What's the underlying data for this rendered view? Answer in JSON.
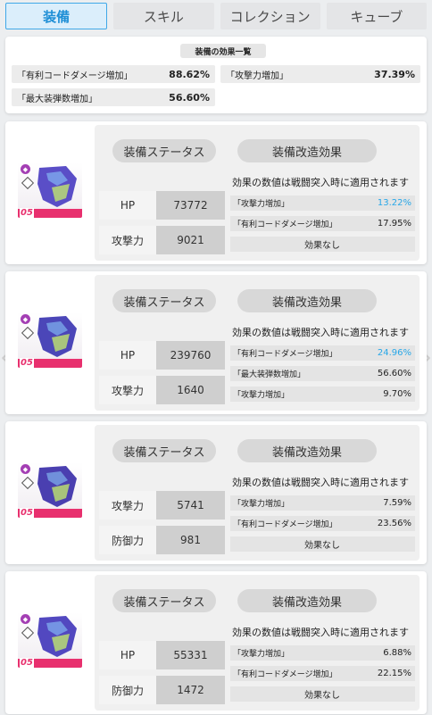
{
  "tabs": [
    {
      "label": "装備",
      "active": true
    },
    {
      "label": "スキル"
    },
    {
      "label": "コレクション"
    },
    {
      "label": "キューブ"
    }
  ],
  "summary": {
    "title": "装備の効果一覧",
    "items": [
      {
        "label": "「有利コードダメージ増加」",
        "value": "88.62%"
      },
      {
        "label": "「攻撃力増加」",
        "value": "37.39%"
      },
      {
        "label": "「最大装弾数増加」",
        "value": "56.60%"
      }
    ]
  },
  "cards": [
    {
      "level": "05",
      "status_header": "装備ステータス",
      "mod_header": "装備改造効果",
      "note": "効果の数値は戦闘突入時に適用されます",
      "stats": [
        {
          "label": "HP",
          "value": "73772"
        },
        {
          "label": "攻撃力",
          "value": "9021"
        }
      ],
      "effects": [
        {
          "label": "「攻撃力増加」",
          "value": "13.22%",
          "highlight": true
        },
        {
          "label": "「有利コードダメージ増加」",
          "value": "17.95%"
        },
        {
          "label": "効果なし",
          "none": true
        }
      ],
      "item_color": "#5a4ec7"
    },
    {
      "level": "05",
      "status_header": "装備ステータス",
      "mod_header": "装備改造効果",
      "note": "効果の数値は戦闘突入時に適用されます",
      "stats": [
        {
          "label": "HP",
          "value": "239760"
        },
        {
          "label": "攻撃力",
          "value": "1640"
        }
      ],
      "effects": [
        {
          "label": "「有利コードダメージ増加」",
          "value": "24.96%",
          "highlight": true
        },
        {
          "label": "「最大装弾数増加」",
          "value": "56.60%"
        },
        {
          "label": "「攻撃力増加」",
          "value": "9.70%"
        }
      ],
      "item_color": "#4b46b8"
    },
    {
      "level": "05",
      "status_header": "装備ステータス",
      "mod_header": "装備改造効果",
      "note": "効果の数値は戦闘突入時に適用されます",
      "stats": [
        {
          "label": "攻撃力",
          "value": "5741"
        },
        {
          "label": "防御力",
          "value": "981"
        }
      ],
      "effects": [
        {
          "label": "「攻撃力増加」",
          "value": "7.59%"
        },
        {
          "label": "「有利コードダメージ増加」",
          "value": "23.56%"
        },
        {
          "label": "効果なし",
          "none": true
        }
      ],
      "item_color": "#4a3fb0"
    },
    {
      "level": "05",
      "status_header": "装備ステータス",
      "mod_header": "装備改造効果",
      "note": "効果の数値は戦闘突入時に適用されます",
      "stats": [
        {
          "label": "HP",
          "value": "55331"
        },
        {
          "label": "防御力",
          "value": "1472"
        }
      ],
      "effects": [
        {
          "label": "「攻撃力増加」",
          "value": "6.88%"
        },
        {
          "label": "「有利コードダメージ増加」",
          "value": "22.15%"
        },
        {
          "label": "効果なし",
          "none": true
        }
      ],
      "item_color": "#5248c0"
    }
  ],
  "icons": {
    "rarity_badge": "rarity-badge-icon",
    "class_diamond": "diamond-icon",
    "nav_left": "chevron-left-icon",
    "nav_right": "chevron-right-icon"
  }
}
